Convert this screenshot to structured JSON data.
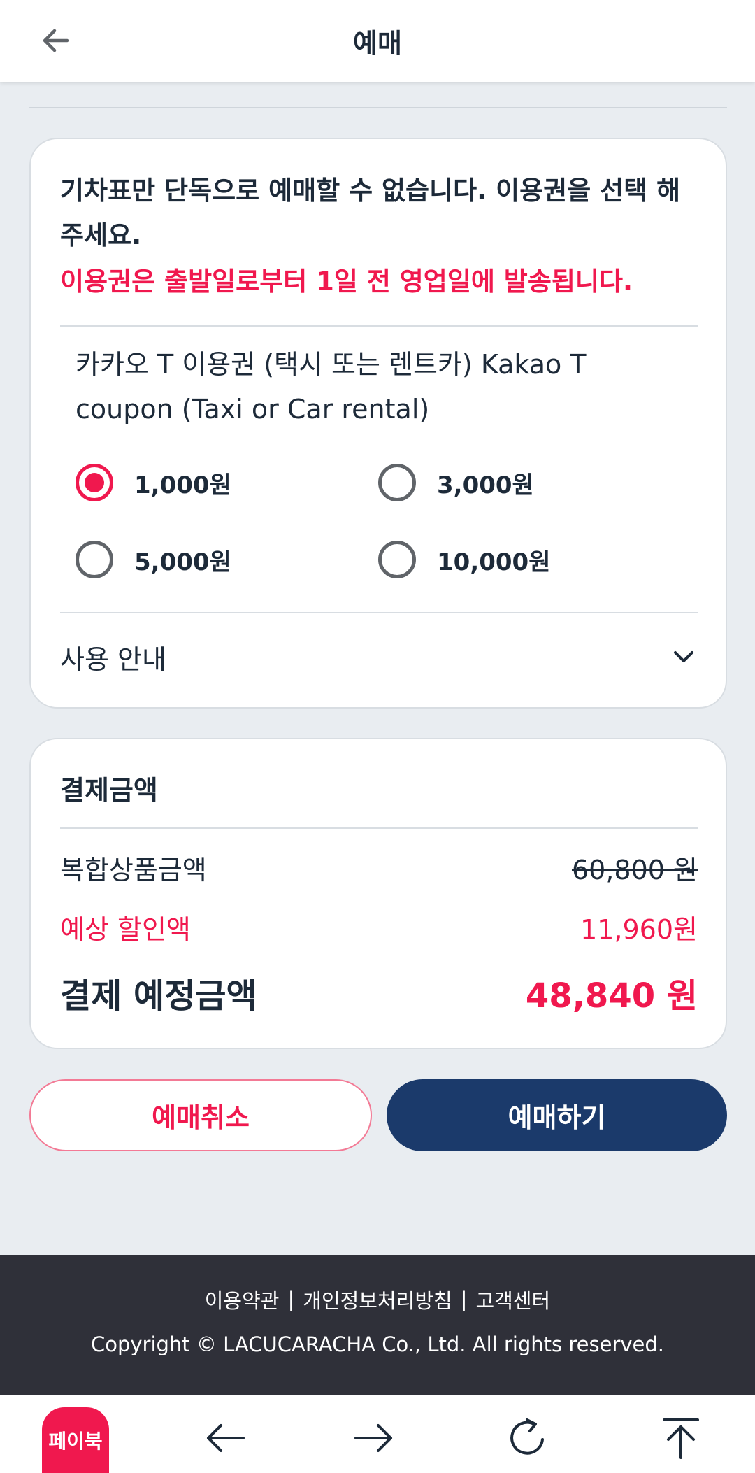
{
  "header": {
    "title": "예매"
  },
  "coupon_card": {
    "notice": "기차표만 단독으로 예매할 수 없습니다. 이용권을 선택 해주세요.",
    "notice_red": "이용권은 출발일로부터 1일 전 영업일에 발송됩니다.",
    "coupon_name": "카카오 T 이용권 (택시 또는 렌트카) Kakao T coupon (Taxi or Car rental)",
    "options": [
      {
        "label": "1,000원",
        "selected": true
      },
      {
        "label": "3,000원",
        "selected": false
      },
      {
        "label": "5,000원",
        "selected": false
      },
      {
        "label": "10,000원",
        "selected": false
      }
    ],
    "guide_label": "사용 안내"
  },
  "payment_card": {
    "title": "결제금액",
    "product_label": "복합상품금액",
    "product_value": "60,800 원",
    "discount_label": "예상 할인액",
    "discount_value": "11,960원",
    "total_label": "결제 예정금액",
    "total_value": "48,840 원"
  },
  "buttons": {
    "cancel_label": "예매취소",
    "book_label": "예매하기"
  },
  "footer": {
    "links": [
      "이용약관",
      "개인정보처리방침",
      "고객센터"
    ],
    "separator": "|",
    "copyright": "Copyright © LACUCARACHA Co., Ltd. All rights reserved."
  },
  "bottom_nav": {
    "logo_text": "페이북",
    "icons": [
      "arrow-left-icon",
      "arrow-right-icon",
      "refresh-icon",
      "scroll-top-icon"
    ]
  },
  "colors": {
    "accent_red": "#f0184e",
    "navy": "#1b3a6b",
    "footer_bg": "#2f3039"
  }
}
